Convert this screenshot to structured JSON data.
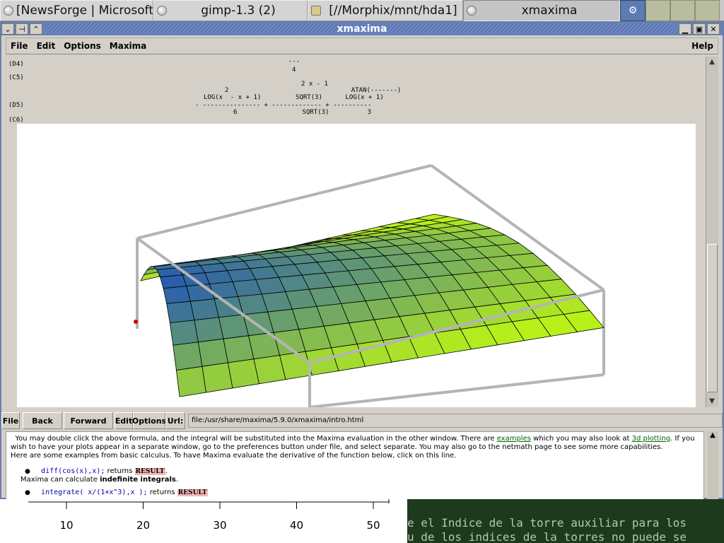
{
  "taskbar": {
    "items": [
      {
        "label": "[NewsForge | Microsoft to"
      },
      {
        "label": "gimp-1.3 (2)"
      },
      {
        "label": "[//Morphix/mnt/hda1]"
      },
      {
        "label": "xmaxima"
      }
    ],
    "tray_icon": "gear-icon"
  },
  "window": {
    "title": "xmaxima",
    "menus": {
      "file": "File",
      "edit": "Edit",
      "options": "Options",
      "maxima": "Maxima",
      "help": "Help"
    }
  },
  "session": {
    "lines": [
      {
        "label": "(D4)",
        "text": "---"
      },
      {
        "label": "",
        "text": "4"
      },
      {
        "label": "(C5)",
        "text": ""
      },
      {
        "label": "",
        "text": "2 x - 1"
      },
      {
        "label": "",
        "text": "2                                ATAN(-------)"
      },
      {
        "label": "",
        "text": "LOG(x  - x + 1)         SQRT(3)      LOG(x + 1)"
      },
      {
        "label": "(D5)",
        "text": "- --------------- + ------------- + ----------"
      },
      {
        "label": "",
        "text": "6                 SQRT(3)          3"
      },
      {
        "label": "(C6)",
        "text": ""
      }
    ]
  },
  "plot": {
    "surface_top_color": "#0b3fcc",
    "surface_bottom_color": "#b8f11a",
    "box_color": "#b4b4b4"
  },
  "browser": {
    "file": "File",
    "back": "Back",
    "forward": "Forward",
    "edit": "Edit",
    "options": "Options",
    "url_label": "Url:",
    "url": "file:/usr/share/maxima/5.9.0/xmaxima/intro.html",
    "para1a": "You may double click the above formula, and the integral will be substituted into the Maxima evaluation in the other window. There are",
    "link_examples": "examples",
    "para1b": "which you may also look at",
    "link_3d": "3d plotting",
    "para1c": ". If you wish to have your plots appear in a separate window, go to the preferences button under file, and select separate. You may also go to the",
    "link_netmath": "netmath page",
    "para1d": "to see some more capabilities.",
    "para2": "Here are some examples from basic calculus. To have Maxima evaluate the derivative of the function below, click on this line.",
    "code1": "diff(cos(x),x);",
    "returns": "returns",
    "result": "RESULT",
    "para3a": "Maxima can calculate",
    "para3b": "indefinite integrals",
    "code2": "integrate( x/(1+x^3),x );"
  },
  "axis_fragment": {
    "ticks": [
      "10",
      "20",
      "30",
      "40",
      "50"
    ]
  },
  "terminal_fragment": {
    "line1": "e el Indice de la torre auxiliar para los",
    "line2": "u de los indices de la torres no puede se"
  }
}
